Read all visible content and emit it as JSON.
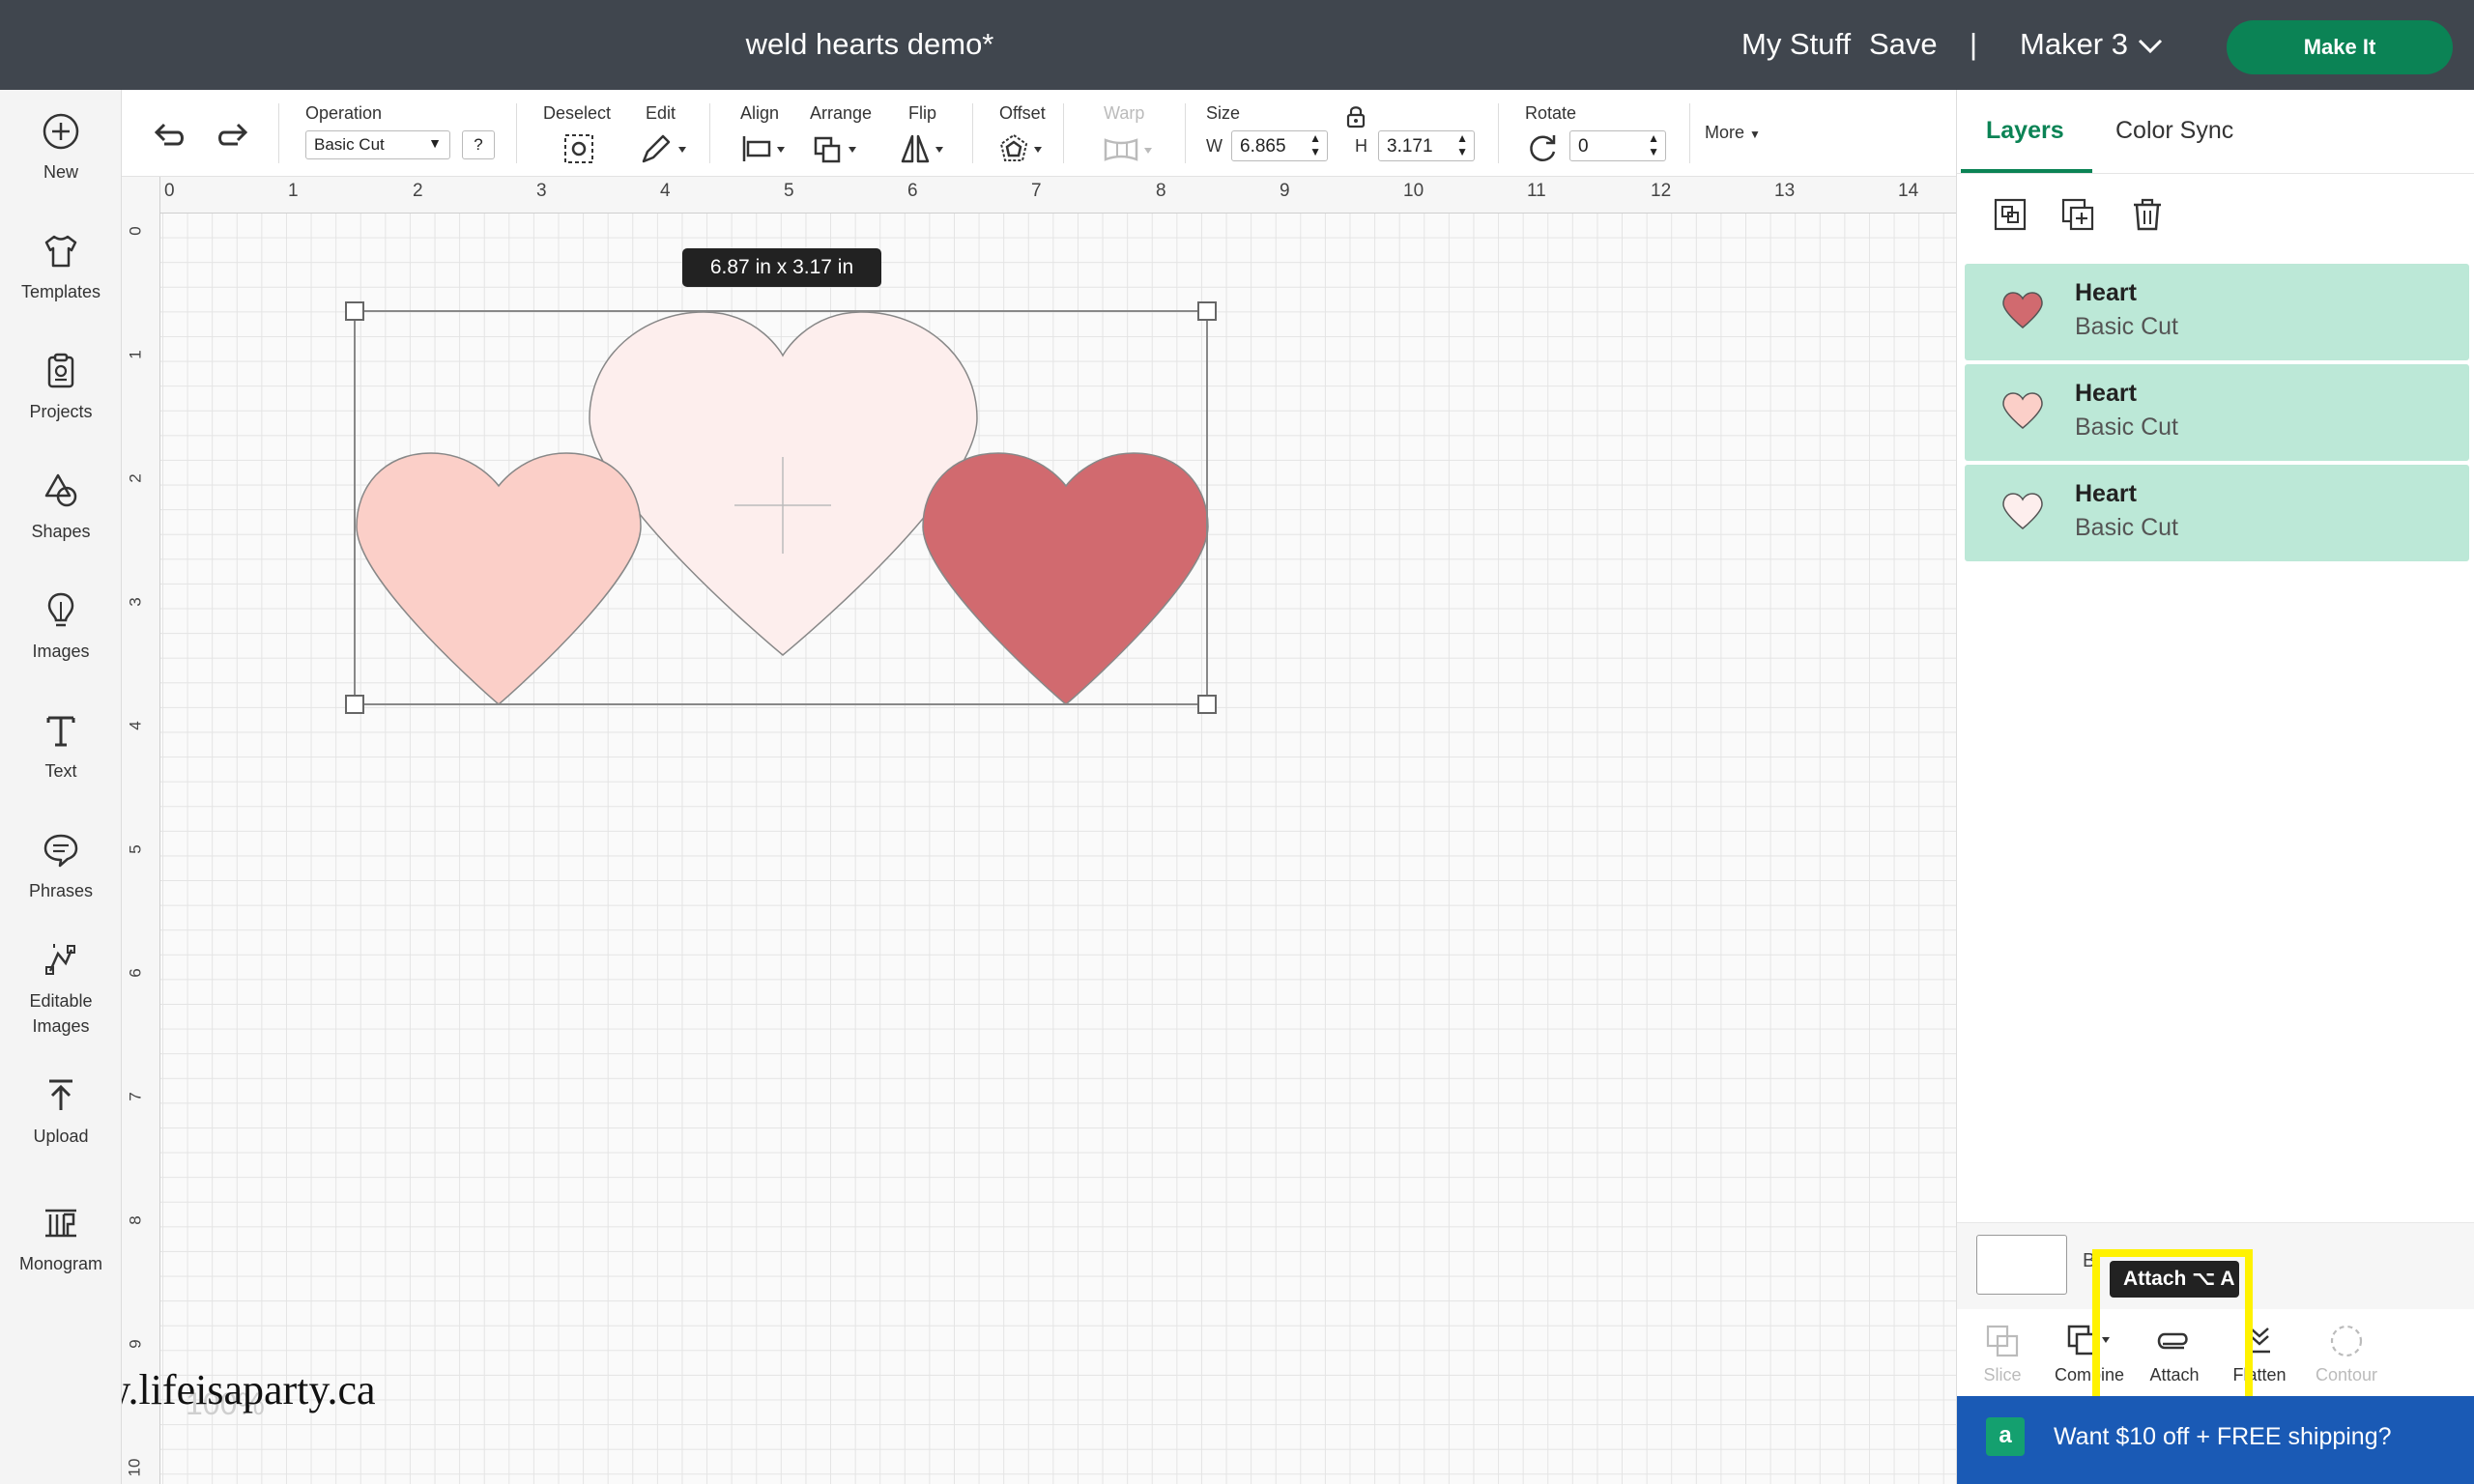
{
  "header": {
    "title": "weld hearts demo*",
    "my_stuff": "My Stuff",
    "save": "Save",
    "separator": "|",
    "machine": "Maker 3",
    "make_it": "Make It"
  },
  "sidebar": {
    "items": [
      {
        "label": "New",
        "icon": "plus-circle-icon"
      },
      {
        "label": "Templates",
        "icon": "shirt-icon"
      },
      {
        "label": "Projects",
        "icon": "clipboard-icon"
      },
      {
        "label": "Shapes",
        "icon": "shapes-icon"
      },
      {
        "label": "Images",
        "icon": "lightbulb-icon"
      },
      {
        "label": "Text",
        "icon": "text-icon"
      },
      {
        "label": "Phrases",
        "icon": "speech-bubble-icon"
      },
      {
        "label": "Editable Images",
        "icon": "editable-image-icon"
      },
      {
        "label": "Upload",
        "icon": "upload-icon"
      },
      {
        "label": "Monogram",
        "icon": "monogram-icon"
      }
    ]
  },
  "toolbar": {
    "operation_label": "Operation",
    "operation_value": "Basic Cut",
    "help": "?",
    "deselect": "Deselect",
    "edit": "Edit",
    "align": "Align",
    "arrange": "Arrange",
    "flip": "Flip",
    "offset": "Offset",
    "warp": "Warp",
    "size": "Size",
    "w_label": "W",
    "w_value": "6.865",
    "h_label": "H",
    "h_value": "3.171",
    "rotate": "Rotate",
    "rotate_value": "0",
    "more": "More"
  },
  "canvas": {
    "ruler_top": [
      "0",
      "1",
      "2",
      "3",
      "4",
      "5",
      "6",
      "7",
      "8",
      "9",
      "10",
      "11",
      "12",
      "13",
      "14"
    ],
    "ruler_left": [
      "0",
      "1",
      "2",
      "3",
      "4",
      "5",
      "6",
      "7",
      "8",
      "9",
      "10"
    ],
    "size_tooltip": "6.87  in x 3.17  in",
    "zoom": "100%",
    "watermark": "www.lifeisaparty.ca",
    "heart_colors": {
      "light": "#fbcfc8",
      "lightest": "#fdeeed",
      "dark": "#d16a6f"
    }
  },
  "panel": {
    "tabs": [
      "Layers",
      "Color Sync"
    ],
    "layers": [
      {
        "name": "Heart",
        "operation": "Basic Cut",
        "color": "#d16a6f"
      },
      {
        "name": "Heart",
        "operation": "Basic Cut",
        "color": "#fbcfc8"
      },
      {
        "name": "Heart",
        "operation": "Basic Cut",
        "color": "#fdeeed"
      }
    ],
    "blank_label": "B",
    "tools": [
      "Slice",
      "Combine",
      "Attach",
      "Flatten",
      "Contour"
    ],
    "attach_tooltip": "Attach ⌥ A",
    "promo": "Want $10 off + FREE shipping?",
    "promo_icon": "a"
  }
}
